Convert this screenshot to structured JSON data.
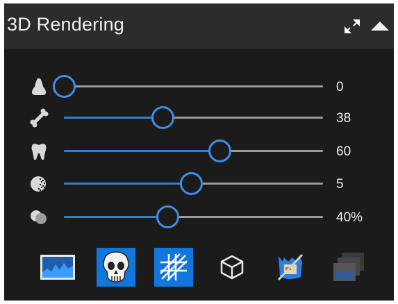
{
  "panel": {
    "title": "3D Rendering",
    "expand_icon": "expand-arrows-icon",
    "collapse_icon": "triangle-up-icon"
  },
  "sliders": [
    {
      "icon": "nose-icon",
      "value": 0,
      "fraction": 0.0,
      "display": "0"
    },
    {
      "icon": "bone-icon",
      "value": 38,
      "fraction": 0.38,
      "display": "38"
    },
    {
      "icon": "tooth-icon",
      "value": 60,
      "fraction": 0.6,
      "display": "60"
    },
    {
      "icon": "dither-ball-icon",
      "value": 5,
      "fraction": 0.49,
      "display": "5"
    },
    {
      "icon": "opacity-icon",
      "value": 40,
      "fraction": 0.4,
      "display": "40%"
    }
  ],
  "tools": [
    {
      "icon": "landscape-image-icon",
      "active": false
    },
    {
      "icon": "skull-icon",
      "active": true
    },
    {
      "icon": "crosshatch-icon",
      "active": true
    },
    {
      "icon": "wireframe-cube-icon",
      "active": false
    },
    {
      "icon": "crossed-out-scan-icon",
      "active": false
    },
    {
      "icon": "stacked-windows-icon",
      "active": false,
      "disabled": true
    }
  ],
  "colors": {
    "accent": "#1177dd",
    "knob": "#3f8ee6",
    "panel": "#1b1b1b",
    "titlebar": "#2c2c2c"
  }
}
